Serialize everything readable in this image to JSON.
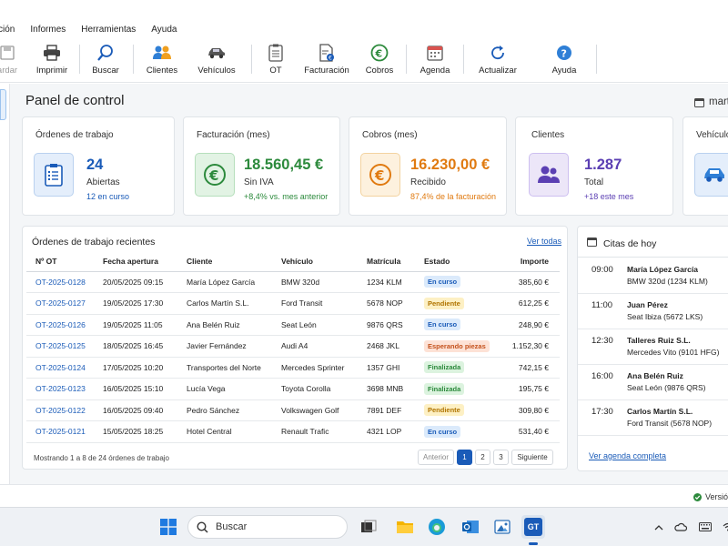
{
  "menu": [
    "ción",
    "Informes",
    "Herramientas",
    "Ayuda"
  ],
  "toolbar": {
    "guardar": "ardar",
    "imprimir": "Imprimir",
    "buscar": "Buscar",
    "clientes": "Clientes",
    "vehiculos": "Vehículos",
    "ot": "OT",
    "facturacion": "Facturación",
    "cobros": "Cobros",
    "agenda": "Agenda",
    "actualizar": "Actualizar",
    "ayuda": "Ayuda"
  },
  "panel": {
    "title": "Panel de control",
    "date": "mart"
  },
  "cards": {
    "ordenes": {
      "title": "Órdenes de trabajo",
      "value": "24",
      "sub": "Abiertas",
      "foot": "12 en curso"
    },
    "facturacion": {
      "title": "Facturación (mes)",
      "value": "18.560,45 €",
      "sub": "Sin IVA",
      "foot": "+8,4% vs. mes anterior"
    },
    "cobros": {
      "title": "Cobros (mes)",
      "value": "16.230,00 €",
      "sub": "Recibido",
      "foot": "87,4% de la facturación"
    },
    "clientes": {
      "title": "Clientes",
      "value": "1.287",
      "sub": "Total",
      "foot": "+18 este mes"
    },
    "vehiculos": {
      "title": "Vehículo"
    }
  },
  "orders": {
    "title": "Órdenes de trabajo recientes",
    "see_all": "Ver todas",
    "headers": [
      "Nº OT",
      "Fecha apertura",
      "Cliente",
      "Vehículo",
      "Matrícula",
      "Estado",
      "Importe"
    ],
    "rows": [
      {
        "ot": "OT-2025-0128",
        "fecha": "20/05/2025 09:15",
        "cliente": "María López García",
        "vehiculo": "BMW 320d",
        "matricula": "1234 KLM",
        "estado": "En curso",
        "importe": "385,60 €"
      },
      {
        "ot": "OT-2025-0127",
        "fecha": "19/05/2025 17:30",
        "cliente": "Carlos Martín S.L.",
        "vehiculo": "Ford Transit",
        "matricula": "5678 NOP",
        "estado": "Pendiente",
        "importe": "612,25 €"
      },
      {
        "ot": "OT-2025-0126",
        "fecha": "19/05/2025 11:05",
        "cliente": "Ana Belén Ruiz",
        "vehiculo": "Seat León",
        "matricula": "9876 QRS",
        "estado": "En curso",
        "importe": "248,90 €"
      },
      {
        "ot": "OT-2025-0125",
        "fecha": "18/05/2025 16:45",
        "cliente": "Javier Fernández",
        "vehiculo": "Audi A4",
        "matricula": "2468 JKL",
        "estado": "Esperando piezas",
        "importe": "1.152,30 €"
      },
      {
        "ot": "OT-2025-0124",
        "fecha": "17/05/2025 10:20",
        "cliente": "Transportes del Norte",
        "vehiculo": "Mercedes Sprinter",
        "matricula": "1357 GHI",
        "estado": "Finalizada",
        "importe": "742,15 €"
      },
      {
        "ot": "OT-2025-0123",
        "fecha": "16/05/2025 15:10",
        "cliente": "Lucía Vega",
        "vehiculo": "Toyota Corolla",
        "matricula": "3698 MNB",
        "estado": "Finalizada",
        "importe": "195,75 €"
      },
      {
        "ot": "OT-2025-0122",
        "fecha": "16/05/2025 09:40",
        "cliente": "Pedro Sánchez",
        "vehiculo": "Volkswagen Golf",
        "matricula": "7891 DEF",
        "estado": "Pendiente",
        "importe": "309,80 €"
      },
      {
        "ot": "OT-2025-0121",
        "fecha": "15/05/2025 18:25",
        "cliente": "Hotel Central",
        "vehiculo": "Renault Trafic",
        "matricula": "4321 LOP",
        "estado": "En curso",
        "importe": "531,40 €"
      }
    ],
    "footer": "Mostrando 1 a 8 de 24 órdenes de trabajo",
    "pager": {
      "prev": "Anterior",
      "p1": "1",
      "p2": "2",
      "p3": "3",
      "next": "Siguiente"
    }
  },
  "badge_colors": {
    "En curso": {
      "bg": "#dbeafb",
      "fg": "#1a5bb8"
    },
    "Pendiente": {
      "bg": "#fdf0c4",
      "fg": "#b07400"
    },
    "Esperando piezas": {
      "bg": "#fde2d6",
      "fg": "#c4511c"
    },
    "Finalizada": {
      "bg": "#dcf3df",
      "fg": "#2c8a3c"
    }
  },
  "citas": {
    "title": "Citas de hoy",
    "items": [
      {
        "time": "09:00",
        "name": "María López García",
        "vehicle": "BMW 320d (1234 KLM)"
      },
      {
        "time": "11:00",
        "name": "Juan Pérez",
        "vehicle": "Seat Ibiza (5672 LKS)"
      },
      {
        "time": "12:30",
        "name": "Talleres Ruiz S.L.",
        "vehicle": "Mercedes Vito (9101 HFG)"
      },
      {
        "time": "16:00",
        "name": "Ana Belén Ruiz",
        "vehicle": "Seat León (9876 QRS)"
      },
      {
        "time": "17:30",
        "name": "Carlos Martín S.L.",
        "vehicle": "Ford Transit (5678 NOP)"
      }
    ],
    "link": "Ver agenda completa"
  },
  "status": {
    "version": "Versión"
  },
  "taskbar": {
    "search_placeholder": "Buscar",
    "app_label": "GT"
  },
  "colors": {
    "accent": "#1a5bb8",
    "green": "#2c8a3c",
    "orange": "#e07a10",
    "purple": "#5b3fb3"
  }
}
